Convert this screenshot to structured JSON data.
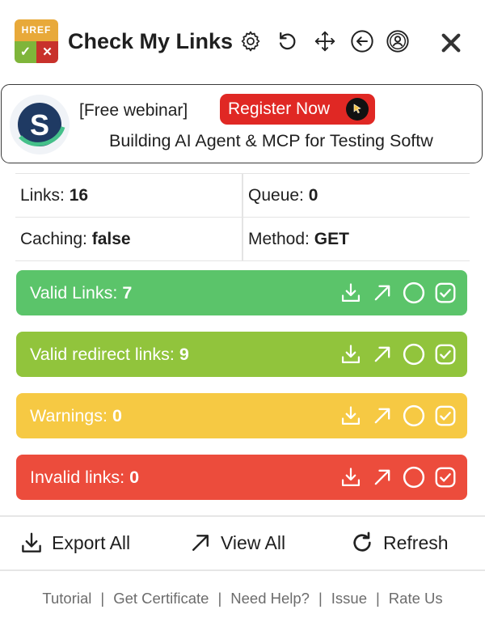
{
  "app": {
    "logo_text": "HREF",
    "title": "Check My Links",
    "header_icons": [
      "gear-icon",
      "refresh-icon",
      "move-icon",
      "back-arrow-icon",
      "account-icon",
      "close-icon"
    ]
  },
  "banner": {
    "title": "[Free webinar]",
    "button_label": "Register Now",
    "subtitle": "Building AI Agent & MCP for Testing Softw",
    "logo_letter": "S"
  },
  "stats": {
    "links_label": "Links:",
    "links_value": "16",
    "queue_label": "Queue:",
    "queue_value": "0",
    "caching_label": "Caching:",
    "caching_value": "false",
    "method_label": "Method:",
    "method_value": "GET"
  },
  "categories": [
    {
      "label": "Valid Links:",
      "count": "7",
      "color": "#5bc46a"
    },
    {
      "label": "Valid redirect links:",
      "count": "9",
      "color": "#91c43c"
    },
    {
      "label": "Warnings:",
      "count": "0",
      "color": "#f6c943"
    },
    {
      "label": "Invalid links:",
      "count": "0",
      "color": "#ec4c3c"
    }
  ],
  "actions": {
    "export_label": "Export All",
    "view_label": "View All",
    "refresh_label": "Refresh"
  },
  "footer": {
    "links": [
      "Tutorial",
      "Get Certificate",
      "Need Help?",
      "Issue",
      "Rate Us"
    ],
    "separator": "|"
  }
}
